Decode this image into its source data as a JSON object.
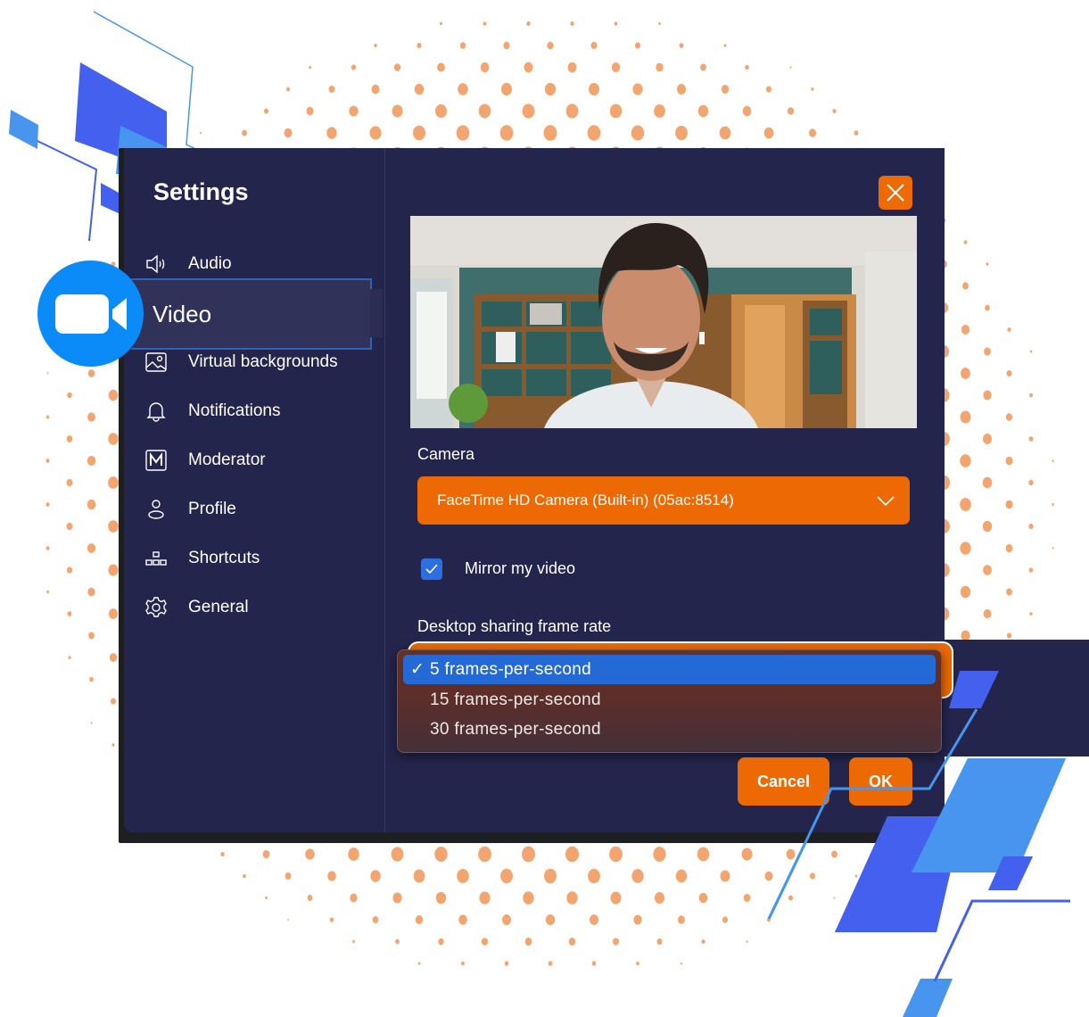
{
  "dialog": {
    "title": "Settings",
    "close_icon": "close-x-icon"
  },
  "sidebar": {
    "items": [
      {
        "label": "Audio",
        "icon": "speaker-icon"
      },
      {
        "label": "Video",
        "icon": "video-camera-icon",
        "active": true
      },
      {
        "label": "Virtual backgrounds",
        "icon": "image-icon"
      },
      {
        "label": "Notifications",
        "icon": "bell-icon"
      },
      {
        "label": "Moderator",
        "icon": "moderator-m-icon"
      },
      {
        "label": "Profile",
        "icon": "person-icon"
      },
      {
        "label": "Shortcuts",
        "icon": "shortcuts-icon"
      },
      {
        "label": "General",
        "icon": "gear-icon"
      }
    ]
  },
  "video": {
    "preview_alt": "Camera preview of a smiling man in an office with bookshelves",
    "camera_label": "Camera",
    "camera_value": "FaceTime HD Camera (Built-in) (05ac:8514)",
    "mirror_label": "Mirror my video",
    "mirror_checked": true,
    "frame_rate_label": "Desktop sharing frame rate",
    "frame_rate_options": [
      {
        "label": "5 frames-per-second",
        "selected": true
      },
      {
        "label": "15 frames-per-second",
        "selected": false
      },
      {
        "label": "30 frames-per-second",
        "selected": false
      }
    ],
    "selected_tick": "✓"
  },
  "buttons": {
    "cancel": "Cancel",
    "ok": "OK"
  },
  "colors": {
    "accent": "#ec6903",
    "panel": "#24254c",
    "selection": "#246ad7",
    "brand_blue": "#0b8bf8",
    "dots": "#f2a56f"
  }
}
